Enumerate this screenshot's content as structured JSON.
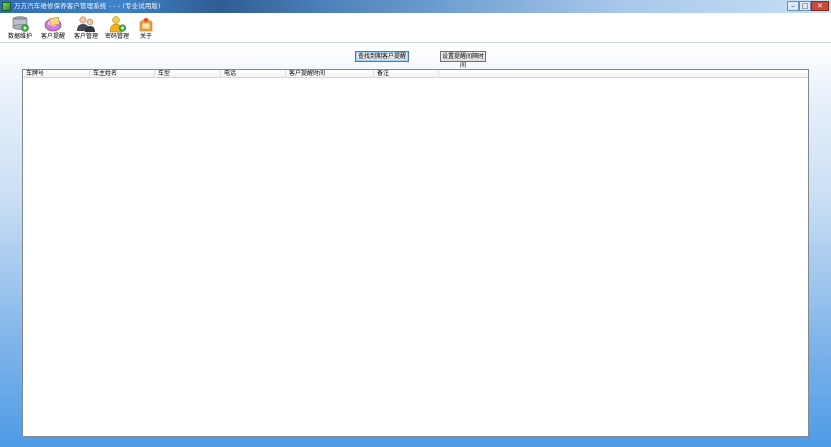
{
  "window": {
    "title": "万方汽车维修保养客户管理系统 - - - (专业试用版)",
    "controls": {
      "minimize": "–",
      "maximize": "□",
      "close": "✕"
    }
  },
  "toolbar": {
    "items": [
      {
        "label": "数据维护",
        "icon": "database-icon"
      },
      {
        "label": "客户提醒",
        "icon": "reminder-icon"
      },
      {
        "label": "客户管理",
        "icon": "customers-icon"
      },
      {
        "label": "密码管理",
        "icon": "user-key-icon"
      },
      {
        "label": "关于",
        "icon": "info-box-icon"
      }
    ]
  },
  "actions": {
    "query_label": "查找到期客户提醒",
    "settings_label": "设置提醒间隔时间"
  },
  "list": {
    "columns": [
      "车牌号",
      "车主姓名",
      "车型",
      "电话",
      "客户提醒时间",
      "备注"
    ],
    "rows": []
  }
}
